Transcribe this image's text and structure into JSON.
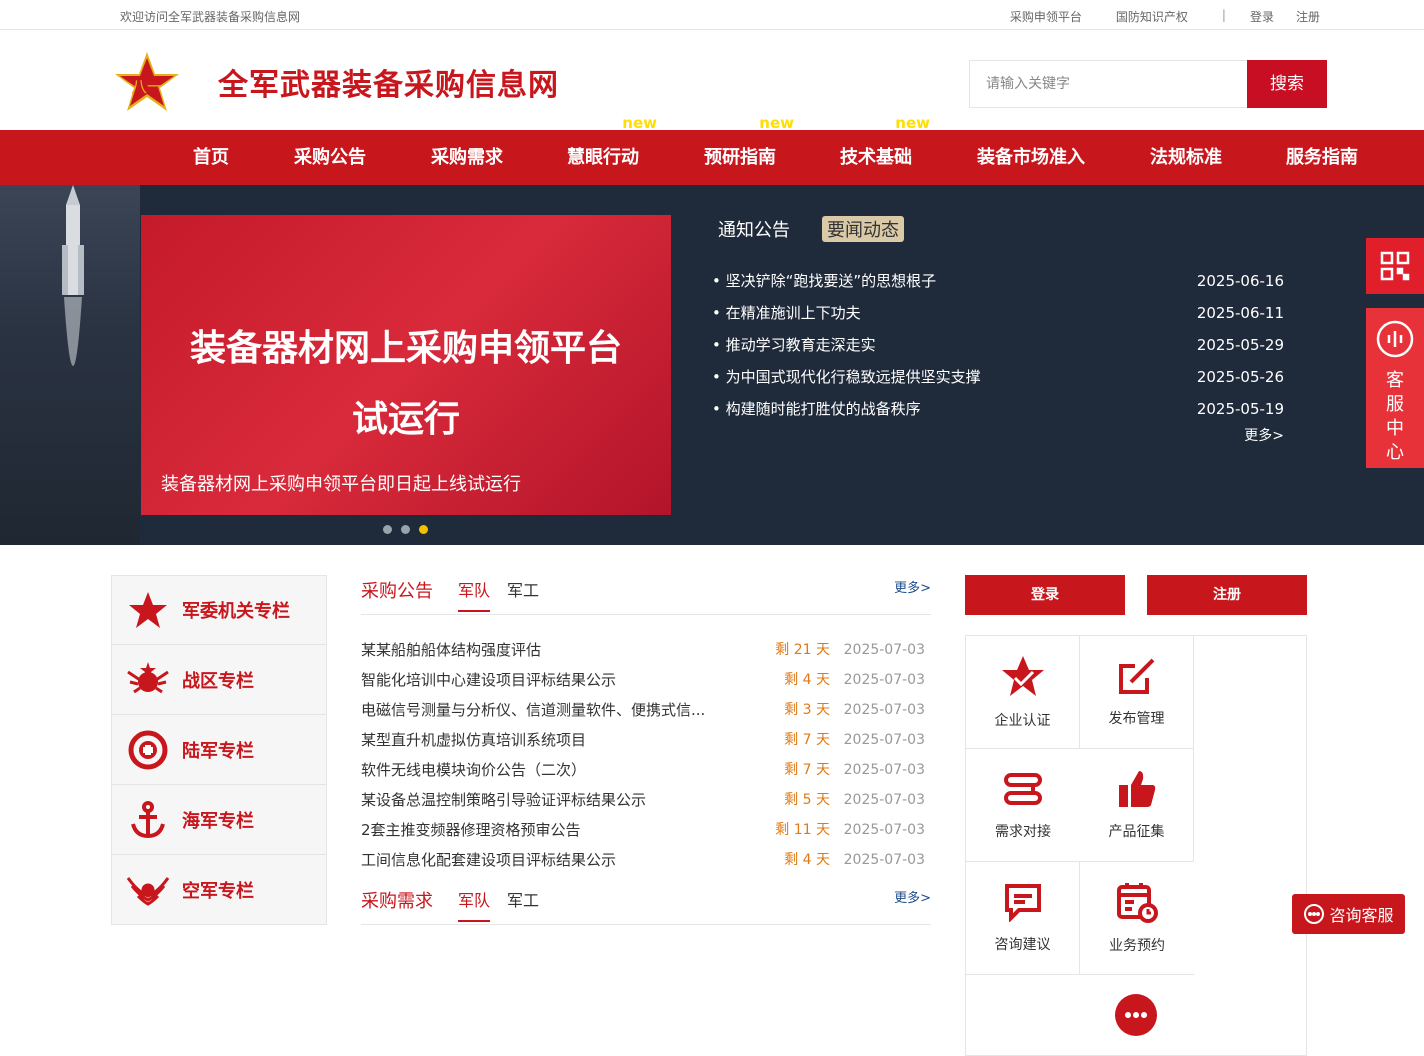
{
  "topbar": {
    "welcome": "欢迎访问全军武器装备采购信息网",
    "link1": "采购申领平台",
    "link2": "国防知识产权",
    "sep": "|",
    "login": "登录",
    "register": "注册"
  },
  "header": {
    "site_name": "全军武器装备采购信息网",
    "search_placeholder": "请输入关键字",
    "search_button": "搜索"
  },
  "nav": {
    "items": [
      {
        "label": "首页"
      },
      {
        "label": "采购公告"
      },
      {
        "label": "采购需求"
      },
      {
        "label": "慧眼行动",
        "badge": "new"
      },
      {
        "label": "预研指南",
        "badge": "new"
      },
      {
        "label": "技术基础",
        "badge": "new"
      },
      {
        "label": "装备市场准入"
      },
      {
        "label": "法规标准"
      },
      {
        "label": "服务指南"
      }
    ]
  },
  "banner": {
    "title_line1": "装备器材网上采购申领平台",
    "title_line2": "试运行",
    "caption": "装备器材网上采购申领平台即日起上线试运行",
    "active_dot": 3,
    "dot_count": 3
  },
  "news": {
    "tab1": "通知公告",
    "tab2": "要闻动态",
    "items": [
      {
        "title": "坚决铲除“跑找要送”的思想根子",
        "date": "2025-06-16"
      },
      {
        "title": "在精准施训上下功夫",
        "date": "2025-06-11"
      },
      {
        "title": "推动学习教育走深走实",
        "date": "2025-05-29"
      },
      {
        "title": "为中国式现代化行稳致远提供坚实支撑",
        "date": "2025-05-26"
      },
      {
        "title": "构建随时能打胜仗的战备秩序",
        "date": "2025-05-19"
      }
    ],
    "more": "更多>"
  },
  "side": {
    "service": "客服中心"
  },
  "columns": [
    {
      "label": "军委机关专栏",
      "icon": "star-icon"
    },
    {
      "label": "战区专栏",
      "icon": "theater-emblem-icon"
    },
    {
      "label": "陆军专栏",
      "icon": "army-emblem-icon"
    },
    {
      "label": "海军专栏",
      "icon": "anchor-icon"
    },
    {
      "label": "空军专栏",
      "icon": "wings-icon"
    }
  ],
  "procurement": {
    "title": "采购公告",
    "tab1": "军队",
    "tab2": "军工",
    "more": "更多>",
    "rows": [
      {
        "title": "某某船舶船体结构强度评估",
        "remain": "剩 21 天",
        "date": "2025-07-03"
      },
      {
        "title": "智能化培训中心建设项目评标结果公示",
        "remain": "剩 4 天",
        "date": "2025-07-03"
      },
      {
        "title": "电磁信号测量与分析仪、信道测量软件、便携式信...",
        "remain": "剩 3 天",
        "date": "2025-07-03"
      },
      {
        "title": "某型直升机虚拟仿真培训系统项目",
        "remain": "剩 7 天",
        "date": "2025-07-03"
      },
      {
        "title": "软件无线电模块询价公告（二次）",
        "remain": "剩 7 天",
        "date": "2025-07-03"
      },
      {
        "title": "某设备总温控制策略引导验证评标结果公示",
        "remain": "剩 5 天",
        "date": "2025-07-03"
      },
      {
        "title": "2套主推变频器修理资格预审公告",
        "remain": "剩 11 天",
        "date": "2025-07-03"
      },
      {
        "title": "工间信息化配套建设项目评标结果公示",
        "remain": "剩 4 天",
        "date": "2025-07-03"
      }
    ]
  },
  "demand": {
    "title": "采购需求",
    "tab1": "军队",
    "tab2": "军工",
    "more": "更多>"
  },
  "account": {
    "login": "登录",
    "register": "注册"
  },
  "services": [
    {
      "label": "企业认证",
      "icon": "certified-star-icon"
    },
    {
      "label": "发布管理",
      "icon": "edit-icon"
    },
    {
      "label": "需求对接",
      "icon": "connect-icon"
    },
    {
      "label": "产品征集",
      "icon": "thumbs-up-icon"
    },
    {
      "label": "咨询建议",
      "icon": "message-icon"
    },
    {
      "label": "业务预约",
      "icon": "calendar-icon"
    }
  ],
  "chat": {
    "label": "咨询客服"
  },
  "colors": {
    "brand_red": "#c8161d",
    "hero_bg": "#1f2a3a",
    "remain_orange": "#e07a16",
    "new_badge": "#ffde00"
  }
}
